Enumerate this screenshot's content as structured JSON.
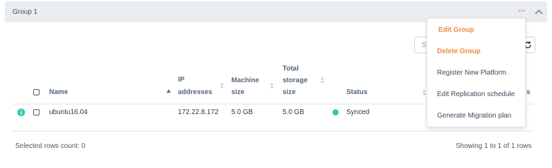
{
  "group": {
    "title": "Group 1",
    "more_icon": "···",
    "accent_color": "#f08a3e"
  },
  "search": {
    "placeholder": "Se"
  },
  "table": {
    "headers": {
      "name": "Name",
      "ip_line1": "IP",
      "ip_line2": "addresses",
      "machine_line1": "Machine",
      "machine_line2": "size",
      "storage_line1": "Total",
      "storage_line2": "storage",
      "storage_line3": "size",
      "status": "Status",
      "extra_tail": "s"
    },
    "rows": [
      {
        "name": "ubuntu16.04",
        "ip": "172.22.8.172",
        "machine_size": "5.0 GB",
        "storage_size": "5.0 GB",
        "status": "Synced",
        "status_color": "#34c6b0"
      }
    ]
  },
  "footer": {
    "selected": "Selected rows count: 0",
    "showing": "Showing 1 to 1 of 1 rows"
  },
  "menu": {
    "items": [
      {
        "label": "Edit Group"
      },
      {
        "label": "Delete Group"
      },
      {
        "label": "Register New Platform"
      },
      {
        "label": "Edit Replication schedule"
      },
      {
        "label": "Generate Migration plan"
      }
    ]
  }
}
